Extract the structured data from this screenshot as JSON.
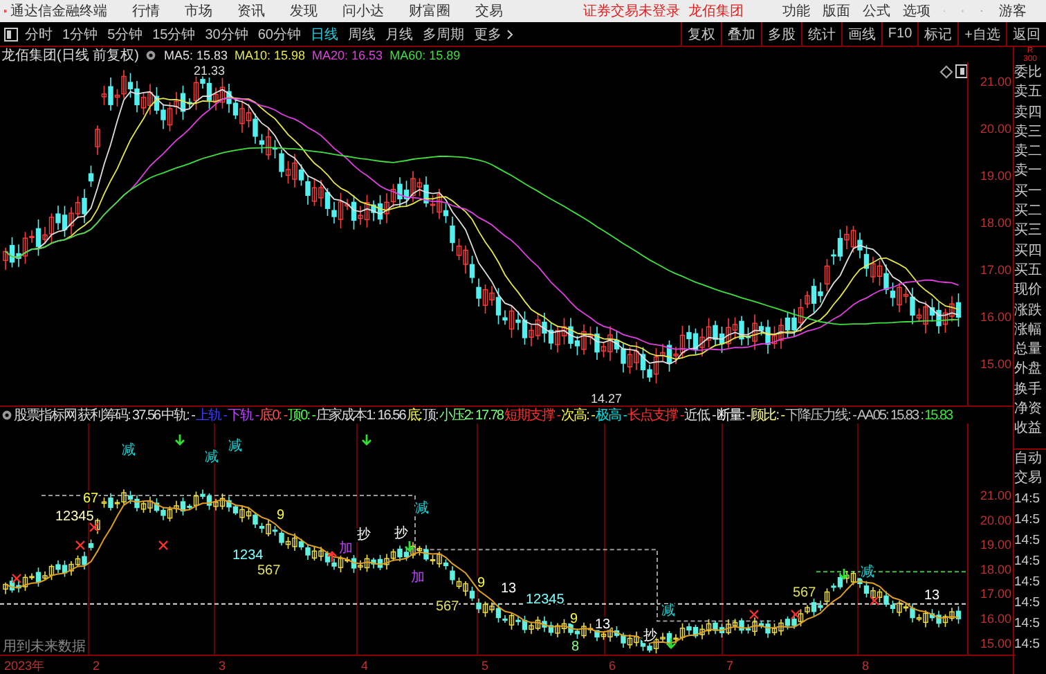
{
  "titlebar": {
    "app_name": "通达信金融终端",
    "menu": [
      "行情",
      "市场",
      "资讯",
      "发现",
      "问小达",
      "财富圈",
      "交易"
    ],
    "login_status": "证券交易未登录",
    "stock_name": "龙佰集团",
    "tools": [
      "功能",
      "版面",
      "公式",
      "选项"
    ],
    "user": "游客"
  },
  "periods": [
    {
      "label": "分时",
      "selected": false
    },
    {
      "label": "1分钟",
      "selected": false
    },
    {
      "label": "5分钟",
      "selected": false
    },
    {
      "label": "15分钟",
      "selected": false
    },
    {
      "label": "30分钟",
      "selected": false
    },
    {
      "label": "60分钟",
      "selected": false
    },
    {
      "label": "日线",
      "selected": true
    },
    {
      "label": "周线",
      "selected": false
    },
    {
      "label": "月线",
      "selected": false
    },
    {
      "label": "多周期",
      "selected": false
    },
    {
      "label": "更多",
      "selected": false
    }
  ],
  "chart_tools": [
    "复权",
    "叠加",
    "多股",
    "统计",
    "画线",
    "F10",
    "标记",
    "+自选",
    "返回"
  ],
  "main_chart": {
    "title": "龙佰集团(日线 前复权)",
    "ma": [
      {
        "label": "MA5: 15.83",
        "color": "#e0e0e0"
      },
      {
        "label": "MA10: 15.98",
        "color": "#e8e84a"
      },
      {
        "label": "MA20: 16.53",
        "color": "#e040e0"
      },
      {
        "label": "MA60: 15.89",
        "color": "#40e040"
      }
    ],
    "high_label": "21.33",
    "low_label": "14.27",
    "yticks": [
      "21.00",
      "20.00",
      "19.00",
      "18.00",
      "17.00",
      "16.00",
      "15.00"
    ]
  },
  "indicator": {
    "name": "股票指标网",
    "items": [
      {
        "text": "获利筹码: 37.56",
        "color": "#dddddd"
      },
      {
        "text": "中轨: -",
        "color": "#dddddd"
      },
      {
        "text": "上轨 -",
        "color": "#3c3cff"
      },
      {
        "text": "下轨 -",
        "color": "#c040ff"
      },
      {
        "text": "底0: -",
        "color": "#ff5050"
      },
      {
        "text": "顶0: -",
        "color": "#50ff50"
      },
      {
        "text": "庄家成本1: 16.56",
        "color": "#dddddd"
      },
      {
        "text": "底:",
        "color": "#ffff40"
      },
      {
        "text": "顶:",
        "color": "#dddddd"
      },
      {
        "text": "小压2: 17.78",
        "color": "#80ff80"
      },
      {
        "text": "短期支撑 -",
        "color": "#ff3030"
      },
      {
        "text": "次高: -",
        "color": "#ffff40"
      },
      {
        "text": "极高 -",
        "color": "#00e0e0"
      },
      {
        "text": "长点支撑 -",
        "color": "#ff3030"
      },
      {
        "text": "近低 -",
        "color": "#dddddd"
      },
      {
        "text": "断量: -",
        "color": "#ffffff"
      },
      {
        "text": "顾比: -",
        "color": "#ffff80"
      },
      {
        "text": "下降压力线: -",
        "color": "#c0c0c0"
      },
      {
        "text": "AA05: 15.83 :",
        "color": "#c0c0c0"
      },
      {
        "text": "15.83",
        "color": "#40e040"
      }
    ],
    "marks": [
      {
        "text": "减",
        "color": "#00e0e0"
      },
      {
        "text": "67",
        "color": "#ffff40"
      },
      {
        "text": "12345",
        "color": "#ffffc0"
      },
      {
        "text": "减",
        "color": "#00e0e0"
      },
      {
        "text": "减",
        "color": "#00e0e0"
      },
      {
        "text": "1234",
        "color": "#80ffff"
      },
      {
        "text": "9",
        "color": "#ffff40"
      },
      {
        "text": "567",
        "color": "#e0e060"
      },
      {
        "text": "减",
        "color": "#00e0e0"
      },
      {
        "text": "抄",
        "color": "#ffffff"
      },
      {
        "text": "抄",
        "color": "#ffffff"
      },
      {
        "text": "加",
        "color": "#c040ff"
      },
      {
        "text": "加",
        "color": "#c040ff"
      },
      {
        "text": "13",
        "color": "#ffffff"
      },
      {
        "text": "9",
        "color": "#ffff40"
      },
      {
        "text": "567",
        "color": "#e0e060"
      },
      {
        "text": "12345",
        "color": "#80ffff"
      },
      {
        "text": "9",
        "color": "#ffff40"
      },
      {
        "text": "8",
        "color": "#80ff80"
      },
      {
        "text": "13",
        "color": "#ffffff"
      },
      {
        "text": "抄",
        "color": "#ffffff"
      },
      {
        "text": "减",
        "color": "#00e0e0"
      },
      {
        "text": "567",
        "color": "#e0e060"
      },
      {
        "text": "减",
        "color": "#00e0e0"
      },
      {
        "text": "13",
        "color": "#ffffff"
      }
    ],
    "yticks": [
      "21.00",
      "20.00",
      "19.00",
      "18.00",
      "17.00",
      "16.00",
      "15.00"
    ],
    "note": "用到未来数据"
  },
  "time_axis": [
    "2023年",
    "2",
    "3",
    "4",
    "5",
    "6",
    "7",
    "8"
  ],
  "quote_panel": {
    "corner": [
      "R",
      "300"
    ],
    "labels": [
      "委比",
      "卖五",
      "卖四",
      "卖三",
      "卖二",
      "卖一",
      "买一",
      "买二",
      "买三",
      "买四",
      "买五",
      "现价",
      "涨跌",
      "涨幅",
      "总量",
      "外盘",
      "换手",
      "净资",
      "收益"
    ],
    "trade_labels": [
      "自动",
      "交易"
    ],
    "times": [
      "14:5",
      "14:5",
      "14:5",
      "14:5",
      "14:5",
      "14:5",
      "14:5",
      "14:5"
    ]
  }
}
